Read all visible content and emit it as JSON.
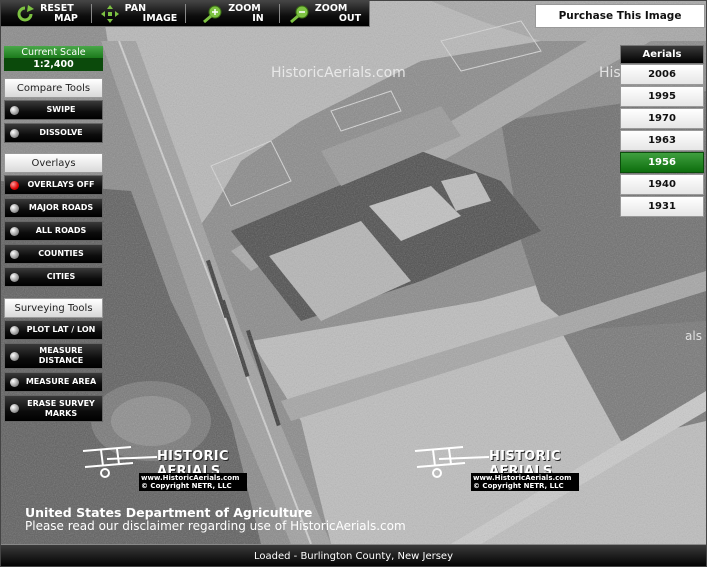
{
  "toolbar": {
    "reset": [
      "RESET",
      "MAP"
    ],
    "pan": [
      "PAN",
      "IMAGE"
    ],
    "zoom_in": [
      "ZOOM",
      "IN"
    ],
    "zoom_out": [
      "ZOOM",
      "OUT"
    ]
  },
  "purchase_label": "Purchase This Image",
  "scale": {
    "label": "Current Scale",
    "value": "1:2,400"
  },
  "sections": {
    "compare": "Compare Tools",
    "overlays": "Overlays",
    "surveying": "Surveying Tools"
  },
  "compare_tools": [
    "SWIPE",
    "DISSOLVE"
  ],
  "overlay_tools": [
    "OVERLAYS OFF",
    "MAJOR ROADS",
    "ALL ROADS",
    "COUNTIES",
    "CITIES"
  ],
  "survey_tools": [
    [
      "PLOT LAT / LON"
    ],
    [
      "MEASURE",
      "DISTANCE"
    ],
    [
      "MEASURE AREA"
    ],
    [
      "ERASE SURVEY",
      "MARKS"
    ]
  ],
  "aerials": {
    "heading": "Aerials",
    "years": [
      "2006",
      "1995",
      "1970",
      "1963",
      "1956",
      "1940",
      "1931"
    ],
    "selected": "1956"
  },
  "map": {
    "watermark": "HistoricAerials.com",
    "watermark_partial": "His",
    "watermark_right_partial": "als",
    "logo_text": "HISTORIC AERIALS",
    "logo_url": "www.HistoricAerials.com",
    "logo_copyright": "© Copyright NETR, LLC",
    "credit": "United States Department of Agriculture",
    "disclaimer": "Please read our disclaimer regarding use of HistoricAerials.com"
  },
  "status": "Loaded - Burlington County, New Jersey",
  "colors": {
    "selected_green": "#127312",
    "toolbar_black": "#000000"
  }
}
